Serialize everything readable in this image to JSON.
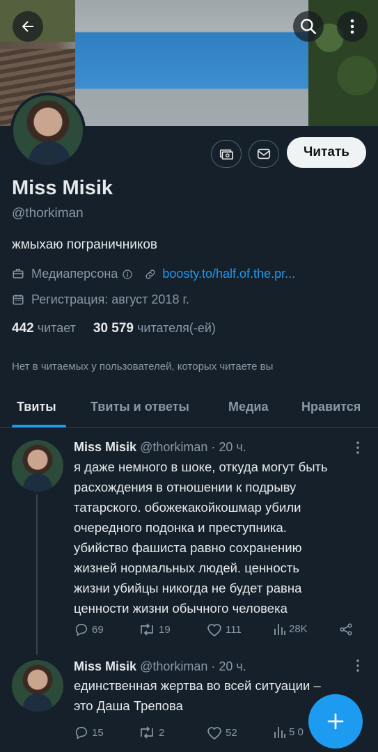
{
  "profile": {
    "follow_label": "Читать",
    "name": "Miss Misik",
    "handle": "@thorkiman",
    "bio": "жмыхаю пограничников",
    "category": "Медиаперсона",
    "link": "boosty.to/half.of.the.pr...",
    "joined": "Регистрация: август 2018 г.",
    "following_count": "442",
    "following_label": "читает",
    "followers_count": "30 579",
    "followers_label": "читателя(-ей)",
    "followed_by": "Нет в читаемых у пользователей, которых читаете вы"
  },
  "tabs": [
    {
      "label": "Твиты",
      "active": true
    },
    {
      "label": "Твиты и ответы",
      "active": false
    },
    {
      "label": "Медиа",
      "active": false
    },
    {
      "label": "Нравится",
      "active": false
    }
  ],
  "tweets": [
    {
      "name": "Miss Misik",
      "meta": "@thorkiman · 20 ч.",
      "lines": [
        "я даже немного в шоке, откуда могут быть",
        "расхождения в отношении к подрыву",
        "татарского. обожекакойкошмар убили",
        "очередного подонка и преступника.",
        "убийство фашиста равно сохранению",
        "жизней нормальных людей. ценность",
        "жизни убийцы никогда не будет равна",
        "ценности жизни обычного человека"
      ],
      "replies": "69",
      "retweets": "19",
      "likes": "111",
      "views": "28K"
    },
    {
      "name": "Miss Misik",
      "meta": "@thorkiman · 20 ч.",
      "lines": [
        "единственная жертва во всей ситуации –",
        "это Даша Трепова"
      ],
      "replies": "15",
      "retweets": "2",
      "likes": "52",
      "views": "5 0"
    }
  ],
  "icons": {
    "back": "arrow-left-icon",
    "search": "search-icon",
    "more": "more-vertical-icon",
    "tip": "money-icon",
    "message": "envelope-icon",
    "compose": "plus-icon"
  },
  "colors": {
    "background": "#15202b",
    "accent": "#1d9bf0",
    "muted": "#8b98a5"
  }
}
